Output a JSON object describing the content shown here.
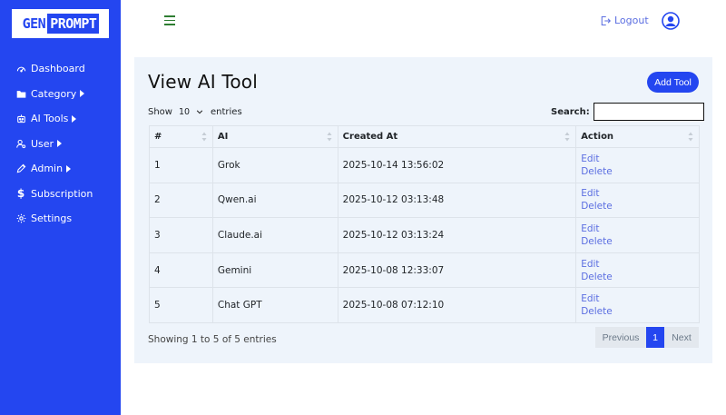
{
  "logo": {
    "part1": "GEN",
    "part2": "PROMPT"
  },
  "sidebar": {
    "items": [
      {
        "label": "Dashboard",
        "icon": "gauge-icon",
        "caret": false
      },
      {
        "label": "Category",
        "icon": "folder-icon",
        "caret": true
      },
      {
        "label": "AI Tools",
        "icon": "robot-icon",
        "caret": true
      },
      {
        "label": "User",
        "icon": "user-gear-icon",
        "caret": true
      },
      {
        "label": "Admin",
        "icon": "pen-icon",
        "caret": true
      },
      {
        "label": "Subscription",
        "icon": "dollar-icon",
        "caret": false
      },
      {
        "label": "Settings",
        "icon": "gear-icon",
        "caret": false
      }
    ]
  },
  "header": {
    "logout_label": "Logout"
  },
  "main": {
    "title": "View AI Tool",
    "add_button": "Add Tool",
    "show_label": "Show",
    "entries_value": "10",
    "entries_label": "entries",
    "search_label": "Search:",
    "search_value": ""
  },
  "table": {
    "headers": [
      "#",
      "AI",
      "Created At",
      "Action"
    ],
    "rows": [
      {
        "num": "1",
        "ai": "Grok",
        "created": "2025-10-14 13:56:02",
        "edit": "Edit",
        "delete": "Delete"
      },
      {
        "num": "2",
        "ai": "Qwen.ai",
        "created": "2025-10-12 03:13:48",
        "edit": "Edit",
        "delete": "Delete"
      },
      {
        "num": "3",
        "ai": "Claude.ai",
        "created": "2025-10-12 03:13:24",
        "edit": "Edit",
        "delete": "Delete"
      },
      {
        "num": "4",
        "ai": "Gemini",
        "created": "2025-10-08 12:33:07",
        "edit": "Edit",
        "delete": "Delete"
      },
      {
        "num": "5",
        "ai": "Chat GPT",
        "created": "2025-10-08 07:12:10",
        "edit": "Edit",
        "delete": "Delete"
      }
    ]
  },
  "footer": {
    "info": "Showing 1 to 5 of 5 entries",
    "previous": "Previous",
    "current_page": "1",
    "next": "Next"
  },
  "colors": {
    "brand": "#2446f0",
    "link": "#5b6ee1",
    "card_bg": "#eef4fb"
  }
}
